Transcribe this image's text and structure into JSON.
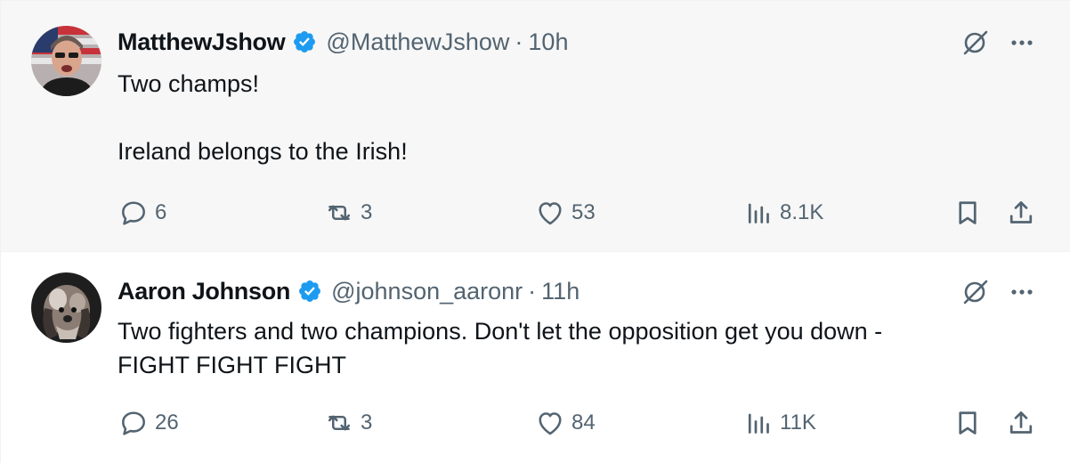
{
  "tweets": [
    {
      "author_name": "MatthewJshow",
      "handle": "@MatthewJshow",
      "separator": "·",
      "time": "10h",
      "text": "Two champs!\n\nIreland belongs to the Irish!",
      "replies": "6",
      "reposts": "3",
      "likes": "53",
      "views": "8.1K",
      "verified": true
    },
    {
      "author_name": "Aaron Johnson",
      "handle": "@johnson_aaronr",
      "separator": "·",
      "time": "11h",
      "text": "Two fighters and two champions. Don't let the opposition get you down -\nFIGHT FIGHT FIGHT",
      "replies": "26",
      "reposts": "3",
      "likes": "84",
      "views": "11K",
      "verified": true
    }
  ],
  "icons": {
    "reply": "reply-icon",
    "repost": "repost-icon",
    "like": "heart-icon",
    "views": "views-icon",
    "bookmark": "bookmark-icon",
    "share": "share-icon",
    "verified": "verified-badge-icon",
    "grok": "grok-icon",
    "more": "more-icon"
  },
  "colors": {
    "verified": "#1d9bf0",
    "muted": "#536471",
    "text": "#0f1419",
    "highlight_bg": "#f7f7f7"
  }
}
